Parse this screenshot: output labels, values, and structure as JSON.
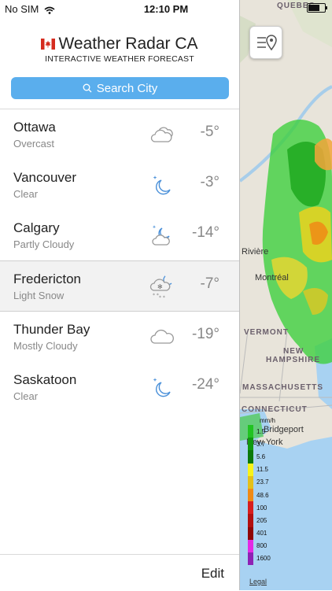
{
  "status": {
    "carrier": "No SIM",
    "time": "12:10 PM",
    "battery_level": 0.8
  },
  "map": {
    "labels": {
      "quebec": "QUEBEC",
      "vermont": "VERMONT",
      "new": "NEW",
      "hampshire": "HAMPSHIRE",
      "massachusetts": "MASSACHUSETTS",
      "connecticut": "CONNECTICUT"
    },
    "cities": {
      "riviere": "Rivière",
      "montreal": "Montréal",
      "bridgeport": "Bridgeport",
      "new_york": "New York"
    },
    "legend": {
      "unit": "mm/h",
      "values": [
        "1.5",
        "3.7",
        "5.6",
        "11.5",
        "23.7",
        "48.6",
        "100",
        "205",
        "401",
        "800",
        "1600"
      ],
      "colors": [
        "#21c321",
        "#109a10",
        "#0a7a0a",
        "#f7f21a",
        "#e4c019",
        "#ef8a16",
        "#d71e1e",
        "#b20f0f",
        "#8f0505",
        "#e42ae4",
        "#8f21b4",
        "#ffffff"
      ]
    },
    "legal": "Legal"
  },
  "brand": {
    "title": "Weather Radar CA",
    "subtitle": "INTERACTIVE WEATHER FORECAST"
  },
  "search": {
    "label": "Search City"
  },
  "cities": [
    {
      "name": "Ottawa",
      "condition": "Overcast",
      "temp": "-5°",
      "icon": "overcast-icon"
    },
    {
      "name": "Vancouver",
      "condition": "Clear",
      "temp": "-3°",
      "icon": "clear-night-icon"
    },
    {
      "name": "Calgary",
      "condition": "Partly Cloudy",
      "temp": "-14°",
      "icon": "partly-cloudy-night-icon"
    },
    {
      "name": "Fredericton",
      "condition": "Light Snow",
      "temp": "-7°",
      "icon": "light-snow-icon"
    },
    {
      "name": "Thunder Bay",
      "condition": "Mostly Cloudy",
      "temp": "-19°",
      "icon": "cloud-icon"
    },
    {
      "name": "Saskatoon",
      "condition": "Clear",
      "temp": "-24°",
      "icon": "clear-night-icon"
    }
  ],
  "footer": {
    "edit": "Edit"
  },
  "colors": {
    "accent": "#5aaeed",
    "moon": "#4a90d9",
    "text_muted": "#888888"
  }
}
